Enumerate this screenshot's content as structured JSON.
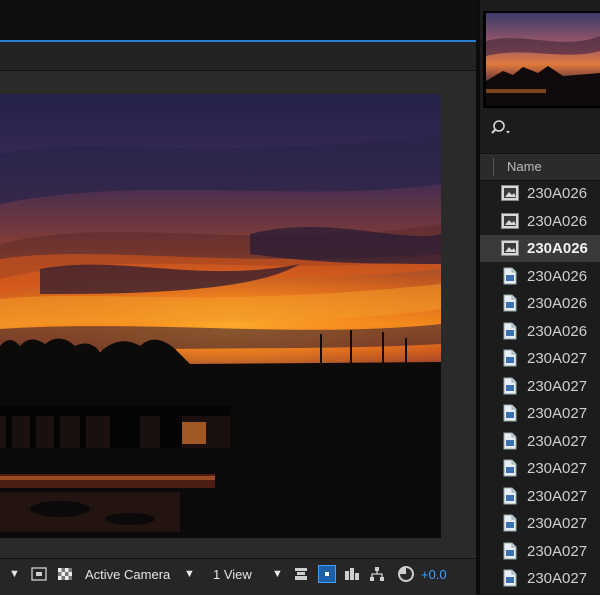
{
  "colors": {
    "accent_blue": "#2a7fd4",
    "panel_bg": "#1e1e1e",
    "selected_row": "#3a3a3a",
    "text": "#cfcfcf",
    "highlight_text": "#3ea0ff"
  },
  "composition": {
    "toolbar": {
      "camera_label": "Active Camera",
      "views_label": "1 View",
      "exposure_value": "+0.0"
    }
  },
  "project": {
    "search_icon": "search-icon",
    "column_name": "Name",
    "items": [
      {
        "label": "230A026",
        "type": "footage-composition",
        "selected": false
      },
      {
        "label": "230A026",
        "type": "footage-composition",
        "selected": false
      },
      {
        "label": "230A026",
        "type": "footage-composition",
        "selected": true
      },
      {
        "label": "230A026",
        "type": "image-file",
        "selected": false
      },
      {
        "label": "230A026",
        "type": "image-file",
        "selected": false
      },
      {
        "label": "230A026",
        "type": "image-file",
        "selected": false
      },
      {
        "label": "230A027",
        "type": "image-file",
        "selected": false
      },
      {
        "label": "230A027",
        "type": "image-file",
        "selected": false
      },
      {
        "label": "230A027",
        "type": "image-file",
        "selected": false
      },
      {
        "label": "230A027",
        "type": "image-file",
        "selected": false
      },
      {
        "label": "230A027",
        "type": "image-file",
        "selected": false
      },
      {
        "label": "230A027",
        "type": "image-file",
        "selected": false
      },
      {
        "label": "230A027",
        "type": "image-file",
        "selected": false
      },
      {
        "label": "230A027",
        "type": "image-file",
        "selected": false
      },
      {
        "label": "230A027",
        "type": "image-file",
        "selected": false
      }
    ]
  }
}
